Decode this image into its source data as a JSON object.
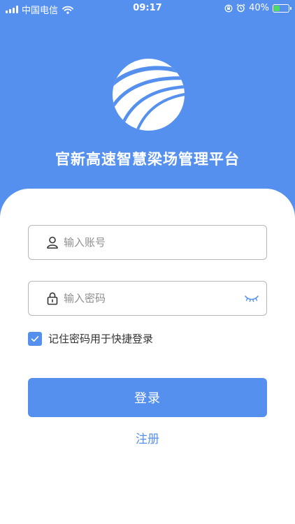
{
  "status_bar": {
    "carrier": "中国电信",
    "time": "09:17",
    "battery": "40%",
    "battery_level": 0.4,
    "icons": [
      "signal-icon",
      "wifi-icon",
      "orientation-lock-icon",
      "alarm-icon",
      "battery-charging-icon"
    ]
  },
  "header": {
    "title": "官新高速智慧梁场管理平台",
    "logo_icon": "highway-logo-icon"
  },
  "form": {
    "account_placeholder": "输入账号",
    "account_value": "",
    "password_placeholder": "输入密码",
    "password_value": "",
    "remember_label": "记住密码用于快捷登录",
    "remember_checked": true,
    "login_label": "登录",
    "register_label": "注册"
  },
  "colors": {
    "primary": "#5690ef",
    "background": "#ffffff",
    "text": "#333333",
    "placeholder": "#8f8f8f",
    "border": "#b7b7b7"
  }
}
